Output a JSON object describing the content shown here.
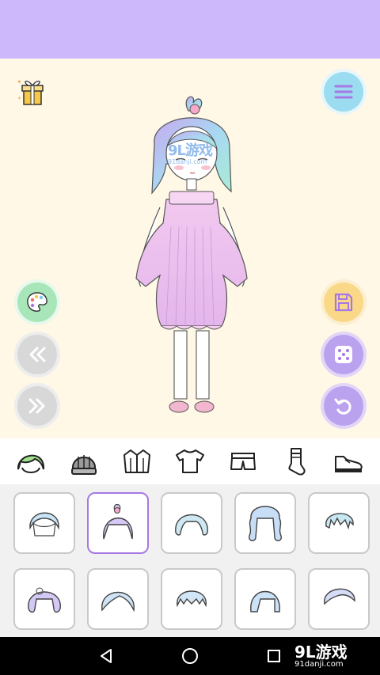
{
  "app": {
    "colors": {
      "topbar": "#cdb8fb",
      "stage_bg": "#fff8e6",
      "menu_btn": "#9bdcf0",
      "palette_btn": "#a8e6b9",
      "nav_btn": "#d8d8d8",
      "save_btn": "#f9d888",
      "action_btn": "#bba2ee",
      "selected_border": "#a678e3"
    }
  },
  "stage": {
    "left_buttons": [
      {
        "name": "palette",
        "icon": "palette-icon"
      },
      {
        "name": "previous",
        "icon": "double-chevron-left-icon"
      },
      {
        "name": "next",
        "icon": "double-chevron-right-icon"
      }
    ],
    "right_buttons": [
      {
        "name": "menu",
        "icon": "hamburger-menu-icon"
      },
      {
        "name": "save",
        "icon": "save-icon"
      },
      {
        "name": "random",
        "icon": "dice-icon"
      },
      {
        "name": "undo",
        "icon": "undo-icon"
      }
    ],
    "gift_icon": "gift-icon",
    "watermark": {
      "brand": "9L游戏",
      "url": "91danji.com"
    }
  },
  "category_tabs": [
    {
      "name": "hair",
      "icon": "hair-icon",
      "active": true
    },
    {
      "name": "hat",
      "icon": "beanie-icon"
    },
    {
      "name": "jacket",
      "icon": "jacket-icon"
    },
    {
      "name": "top",
      "icon": "tshirt-icon"
    },
    {
      "name": "bottom",
      "icon": "shorts-icon"
    },
    {
      "name": "socks",
      "icon": "sock-icon"
    },
    {
      "name": "shoes",
      "icon": "shoe-icon"
    }
  ],
  "items": {
    "selected_index": 1,
    "count": 10
  },
  "navbar": {
    "buttons": [
      "back-icon",
      "home-icon",
      "recents-icon"
    ],
    "watermark": {
      "brand": "9L游戏",
      "url": "91danji.com"
    }
  }
}
